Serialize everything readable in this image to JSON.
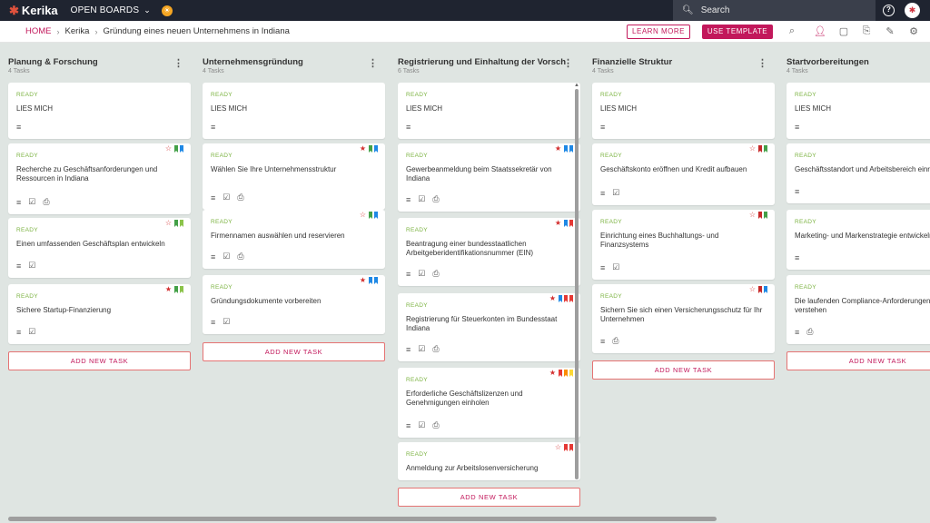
{
  "app": {
    "logo": "Kerika",
    "boards_menu": "OPEN BOARDS"
  },
  "search": {
    "placeholder": "Search"
  },
  "breadcrumb": {
    "home": "HOME",
    "org": "Kerika",
    "board": "Gründung eines neuen Unternehmens in Indiana"
  },
  "toolbar": {
    "learn_more": "LEARN MORE",
    "use_template": "USE TEMPLATE"
  },
  "colors": {
    "accent": "#c2185b",
    "ready": "#7cb342",
    "topbar": "#1f2430"
  },
  "columns": [
    {
      "title": "Planung & Forschung",
      "count": "4 Tasks",
      "add_label": "ADD NEW TASK",
      "cards": [
        {
          "status": "READY",
          "title": "LIES MICH",
          "icons": [
            "details"
          ],
          "flags": []
        },
        {
          "status": "READY",
          "title": "Recherche zu Geschäftsanforderungen und Ressourcen in Indiana",
          "icons": [
            "details",
            "checklist",
            "attachment"
          ],
          "star": "outline",
          "flags": [
            "#43a047",
            "#1e88e5"
          ]
        },
        {
          "status": "READY",
          "title": "Einen umfassenden Geschäftsplan entwickeln",
          "icons": [
            "details",
            "checklist"
          ],
          "star": "outline",
          "flags": [
            "#43a047",
            "#8bc34a"
          ]
        },
        {
          "status": "READY",
          "title": "Sichere Startup-Finanzierung",
          "icons": [
            "details",
            "checklist"
          ],
          "star": "filled",
          "flags": [
            "#43a047",
            "#8bc34a"
          ]
        }
      ]
    },
    {
      "title": "Unternehmensgründung",
      "count": "4 Tasks",
      "add_label": "ADD NEW TASK",
      "cards": [
        {
          "status": "READY",
          "title": "LIES MICH",
          "icons": [
            "details"
          ],
          "flags": []
        },
        {
          "status": "READY",
          "title": "Wählen Sie Ihre Unternehmensstruktur",
          "icons": [
            "details",
            "checklist",
            "attachment"
          ],
          "star": "filled",
          "flags": [
            "#43a047",
            "#1e88e5"
          ]
        },
        {
          "status": "READY",
          "title": "Firmennamen auswählen und reservieren",
          "icons": [
            "details",
            "checklist",
            "attachment"
          ],
          "star": "outline",
          "flags": [
            "#43a047",
            "#1e88e5"
          ]
        },
        {
          "status": "READY",
          "title": "Gründungsdokumente vorbereiten",
          "icons": [
            "details",
            "checklist"
          ],
          "star": "filled",
          "flags": [
            "#1e88e5",
            "#1e88e5"
          ]
        }
      ]
    },
    {
      "title": "Registrierung und Einhaltung der Vorschr...",
      "count": "6 Tasks",
      "add_label": "ADD NEW TASK",
      "cards": [
        {
          "status": "READY",
          "title": "LIES MICH",
          "icons": [
            "details"
          ],
          "flags": []
        },
        {
          "status": "READY",
          "title": "Gewerbeanmeldung beim Staatssekretär von Indiana",
          "icons": [
            "details",
            "checklist",
            "attachment"
          ],
          "star": "filled",
          "flags": [
            "#1e88e5",
            "#1e88e5"
          ]
        },
        {
          "status": "READY",
          "title": "Beantragung einer bundesstaatlichen Arbeitgeberidentifikationsnummer (EIN)",
          "icons": [
            "details",
            "checklist",
            "attachment"
          ],
          "star": "filled",
          "flags": [
            "#1e88e5",
            "#e53935"
          ]
        },
        {
          "status": "READY",
          "title": "Registrierung für Steuerkonten im Bundesstaat Indiana",
          "icons": [
            "details",
            "checklist",
            "attachment"
          ],
          "star": "filled",
          "flags": [
            "#1e88e5",
            "#e53935",
            "#e53935"
          ]
        },
        {
          "status": "READY",
          "title": "Erforderliche Geschäftslizenzen und Genehmigungen einholen",
          "icons": [
            "details",
            "checklist",
            "attachment"
          ],
          "star": "filled",
          "flags": [
            "#e53935",
            "#fb8c00",
            "#fdd835"
          ]
        },
        {
          "status": "READY",
          "title": "Anmeldung zur Arbeitslosenversicherung",
          "icons": [],
          "star": "outline",
          "flags": [
            "#e53935",
            "#e53935"
          ]
        }
      ]
    },
    {
      "title": "Finanzielle Struktur",
      "count": "4 Tasks",
      "add_label": "ADD NEW TASK",
      "cards": [
        {
          "status": "READY",
          "title": "LIES MICH",
          "icons": [
            "details"
          ],
          "flags": []
        },
        {
          "status": "READY",
          "title": "Geschäftskonto eröffnen und Kredit aufbauen",
          "icons": [
            "details",
            "checklist"
          ],
          "star": "outline",
          "flags": [
            "#c62828",
            "#43a047"
          ]
        },
        {
          "status": "READY",
          "title": "Einrichtung eines Buchhaltungs- und Finanzsystems",
          "icons": [
            "details",
            "checklist"
          ],
          "star": "outline",
          "flags": [
            "#c62828",
            "#43a047"
          ]
        },
        {
          "status": "READY",
          "title": "Sichern Sie sich einen Versicherungsschutz für Ihr Unternehmen",
          "icons": [
            "details",
            "attachment"
          ],
          "star": "outline",
          "flags": [
            "#c62828",
            "#1e88e5"
          ]
        }
      ]
    },
    {
      "title": "Startvorbereitungen",
      "count": "4 Tasks",
      "add_label": "ADD NEW TASK",
      "cards": [
        {
          "status": "READY",
          "title": "LIES MICH",
          "icons": [
            "details"
          ],
          "flags": []
        },
        {
          "status": "READY",
          "title": "Geschäftsstandort und Arbeitsbereich einrichten",
          "icons": [
            "details"
          ],
          "flags": []
        },
        {
          "status": "READY",
          "title": "Marketing- und Markenstrategie entwickeln",
          "icons": [
            "details"
          ],
          "flags": []
        },
        {
          "status": "READY",
          "title": "Die laufenden Compliance-Anforderungen verstehen",
          "icons": [
            "details",
            "attachment"
          ],
          "flags": []
        }
      ]
    }
  ]
}
